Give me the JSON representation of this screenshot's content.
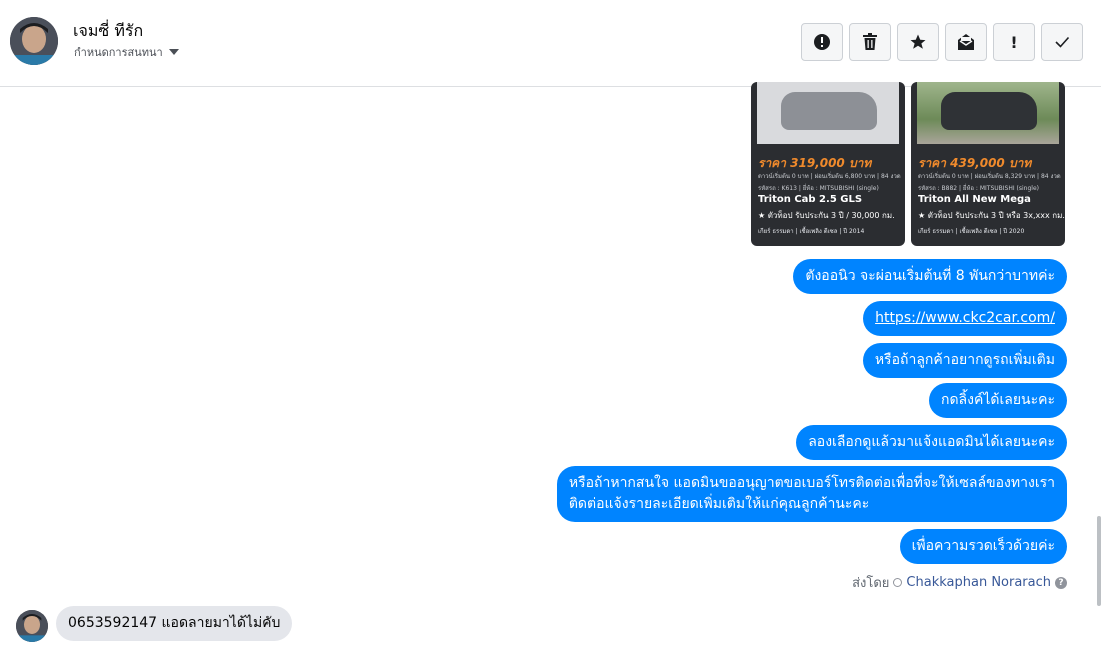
{
  "header": {
    "contact_name": "เจมซี่ ทีรัก",
    "subtitle": "กำหนดการสนทนา",
    "toolbar": [
      {
        "icon": "alert-circle-icon",
        "glyph": "❗"
      },
      {
        "icon": "trash-icon",
        "glyph": "🗑"
      },
      {
        "icon": "star-icon",
        "glyph": "★"
      },
      {
        "icon": "mark-unread-icon",
        "glyph": "✉"
      },
      {
        "icon": "exclamation-icon",
        "glyph": "!"
      },
      {
        "icon": "check-icon",
        "glyph": "✓"
      }
    ]
  },
  "cards": [
    {
      "price": "ราคา 319,000 บาท",
      "terms": "ดาวน์เริ่มต้น 0 บาท | ผ่อนเริ่มต้น 6,800 บาท | 84 งวด",
      "meta": "รหัสรถ : K613 | ยี่ห้อ : MITSUBISHI (single)",
      "model": "Triton Cab 2.5 GLS",
      "warranty": "★ ตัวท็อป รับประกัน 3 ปี / 30,000 กม.",
      "footer": "เกียร์ ธรรมดา  |  เชื้อเพลิง ดีเซล  |  ปี 2014"
    },
    {
      "price": "ราคา 439,000 บาท",
      "terms": "ดาวน์เริ่มต้น 0 บาท | ผ่อนเริ่มต้น 8,329 บาท | 84 งวด",
      "meta": "รหัสรถ : B882 | ยี่ห้อ : MITSUBISHI (single)",
      "model": "Triton All New Mega",
      "warranty": "★ ตัวท็อป รับประกัน 3 ปี หรือ 3x,xxx กม.",
      "footer": "เกียร์ ธรรมดา  |  เชื้อเพลิง ดีเซล  |  ปี 2020"
    }
  ],
  "messages": [
    {
      "text": "ตังออนิว จะผ่อนเริ่มต้นที่ 8 พันกว่าบาทค่ะ"
    },
    {
      "text": "https://www.ckc2car.com/",
      "link": true
    },
    {
      "text": "หรือถ้าลูกค้าอยากดูรถเพิ่มเติม"
    },
    {
      "text": "กดลิ้งค์ได้เลยนะคะ"
    },
    {
      "text": "ลองเลือกดูแล้วมาแจ้งแอดมินได้เลยนะคะ"
    },
    {
      "line1": "หรือถ้าหากสนใจ แอดมินขออนุญาตขอเบอร์โทรติดต่อเพื่อที่จะให้เซลล์ของทางเรา",
      "line2": "ติดต่อแจ้งรายละเอียดเพิ่มเติมให้แก่คุณลูกค้านะคะ"
    },
    {
      "text": "เพื่อความรวดเร็วด้วยค่ะ"
    }
  ],
  "sent_by": {
    "label": "ส่งโดย",
    "name": "Chakkaphan Norarach"
  },
  "incoming": {
    "text": "0653592147 แอดลายมาได้ไม่คับ"
  },
  "colors": {
    "bubble": "#0084ff",
    "incoming": "#e4e6eb",
    "price": "#f08a2c"
  }
}
